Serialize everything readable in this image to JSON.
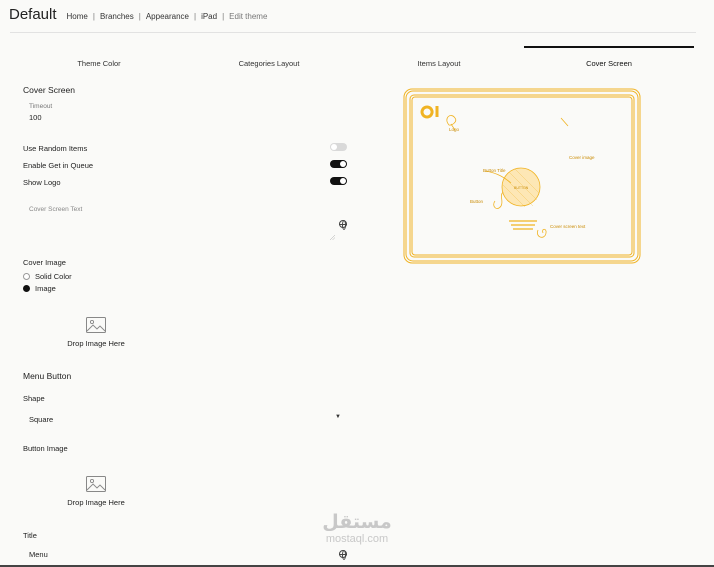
{
  "header": {
    "title": "Default",
    "breadcrumbs": [
      "Home",
      "Branches",
      "Appearance",
      "iPad",
      "Edit theme"
    ],
    "separator": "|"
  },
  "tabs": [
    {
      "label": "Theme Color",
      "active": false
    },
    {
      "label": "Categories Layout",
      "active": false
    },
    {
      "label": "Items Layout",
      "active": false
    },
    {
      "label": "Cover Screen",
      "active": true
    }
  ],
  "cover": {
    "section_title": "Cover Screen",
    "timeout_label": "Timeout",
    "timeout_value": "100",
    "use_random_items_label": "Use Random Items",
    "use_random_items": false,
    "enable_queue_label": "Enable Get in Queue",
    "enable_queue": true,
    "show_logo_label": "Show Logo",
    "show_logo": true,
    "text_placeholder": "Cover Screen Text",
    "image_label": "Cover Image",
    "options": [
      "Solid Color",
      "Image"
    ],
    "selected_option": "Image",
    "drop_text": "Drop Image Here"
  },
  "menu_button": {
    "section_title": "Menu Button",
    "shape_label": "Shape",
    "shape_value": "Square",
    "button_image_label": "Button Image",
    "drop_text": "Drop Image Here",
    "title_label": "Title",
    "title_value": "Menu"
  },
  "preview": {
    "labels": {
      "logo": "Logo",
      "cover_image": "Cover image",
      "button_title": "Button Title",
      "button": "Button",
      "cover_screen_text": "Cover screen text",
      "button_inner": "BUTTON"
    },
    "accent": "#f0b323"
  },
  "watermark": {
    "arabic": "مستقل",
    "latin": "mostaql.com"
  },
  "icons": {
    "globe": "globe-icon",
    "image": "image-placeholder-icon",
    "caret": "chevron-down-icon"
  }
}
